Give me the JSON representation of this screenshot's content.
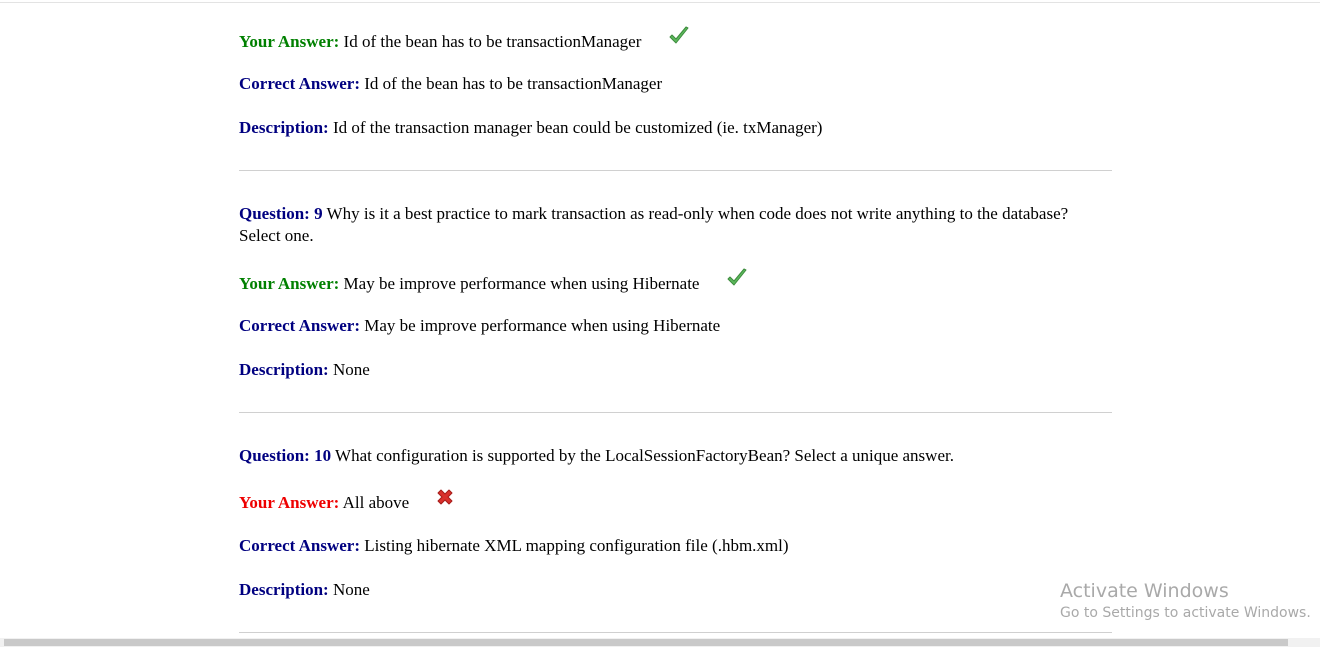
{
  "labels": {
    "question": "Question:",
    "your_answer": "Your Answer:",
    "correct_answer": "Correct Answer:",
    "description": "Description:"
  },
  "q8": {
    "your_answer": "Id of the bean has to be transactionManager",
    "your_answer_status": "correct",
    "correct_answer": "Id of the bean has to be transactionManager",
    "description": "Id of the transaction manager bean could be customized (ie. txManager)"
  },
  "q9": {
    "number": "9",
    "text": "Why is it a best practice to mark transaction as read-only when code does not write anything to the database? Select one.",
    "your_answer": "May be improve performance when using Hibernate",
    "your_answer_status": "correct",
    "correct_answer": "May be improve performance when using Hibernate",
    "description": "None"
  },
  "q10": {
    "number": "10",
    "text": "What configuration is supported by the LocalSessionFactoryBean? Select a unique answer.",
    "your_answer": "All above",
    "your_answer_status": "incorrect",
    "correct_answer": "Listing hibernate XML mapping configuration file (.hbm.xml)",
    "description": "None"
  },
  "watermark": {
    "title": "Activate Windows",
    "subtitle": "Go to Settings to activate Windows."
  },
  "colors": {
    "label_blue": "#000080",
    "correct_green": "#008000",
    "incorrect_red": "#ee0000"
  }
}
